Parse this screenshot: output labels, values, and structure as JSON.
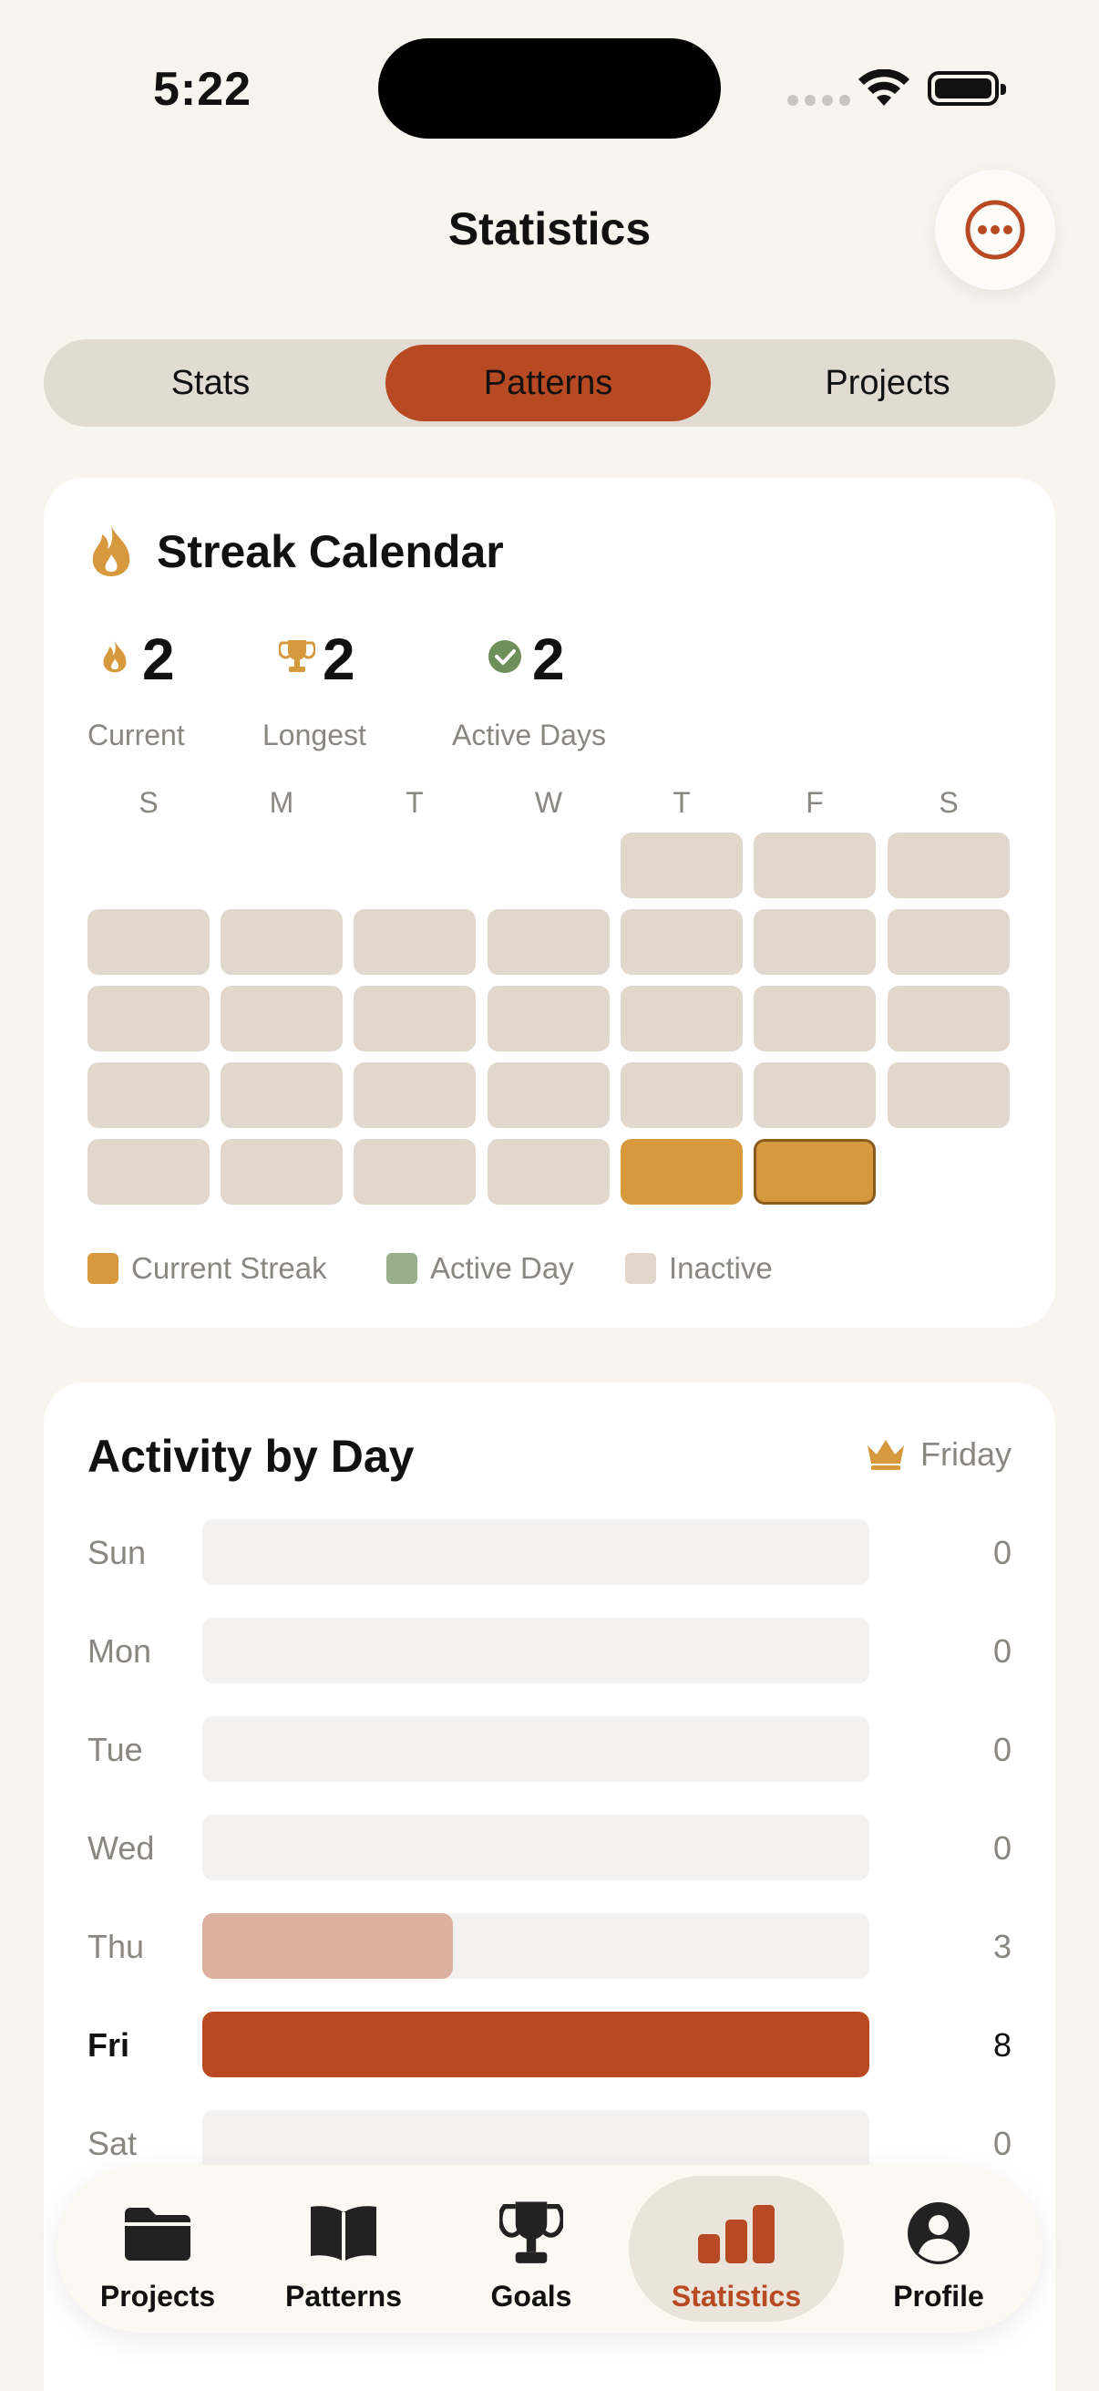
{
  "status_bar": {
    "time": "5:22"
  },
  "header": {
    "title": "Statistics",
    "more_icon": "ellipsis-circle-icon"
  },
  "segments": [
    {
      "label": "Stats",
      "selected": false
    },
    {
      "label": "Patterns",
      "selected": true
    },
    {
      "label": "Projects",
      "selected": false
    }
  ],
  "streak_calendar": {
    "title": "Streak Calendar",
    "stats": [
      {
        "value": "2",
        "label": "Current",
        "icon": "flame-icon"
      },
      {
        "value": "2",
        "label": "Longest",
        "icon": "trophy-icon"
      },
      {
        "value": "2",
        "label": "Active Days",
        "icon": "check-circle-icon"
      }
    ],
    "weekdays": [
      "S",
      "M",
      "T",
      "W",
      "T",
      "F",
      "S"
    ],
    "legend": {
      "current_streak": "Current Streak",
      "active_day": "Active Day",
      "inactive": "Inactive"
    },
    "colors": {
      "streak": "#d6993e",
      "active": "#9aae8a",
      "inactive": "#e2d7cc"
    }
  },
  "activity": {
    "title": "Activity by Day",
    "best_day": "Friday",
    "best_icon": "crown-icon",
    "days": [
      {
        "label": "Sun",
        "value": 0
      },
      {
        "label": "Mon",
        "value": 0
      },
      {
        "label": "Tue",
        "value": 0
      },
      {
        "label": "Wed",
        "value": 0
      },
      {
        "label": "Thu",
        "value": 3
      },
      {
        "label": "Fri",
        "value": 8
      },
      {
        "label": "Sat",
        "value": 0
      }
    ],
    "max": 8
  },
  "tabbar": [
    {
      "label": "Projects",
      "icon": "folder-icon",
      "active": false
    },
    {
      "label": "Patterns",
      "icon": "book-icon",
      "active": false
    },
    {
      "label": "Goals",
      "icon": "trophy-icon",
      "active": false
    },
    {
      "label": "Statistics",
      "icon": "bar-chart-icon",
      "active": true
    },
    {
      "label": "Profile",
      "icon": "person-circle-icon",
      "active": false
    }
  ],
  "accent": "#b74a22"
}
